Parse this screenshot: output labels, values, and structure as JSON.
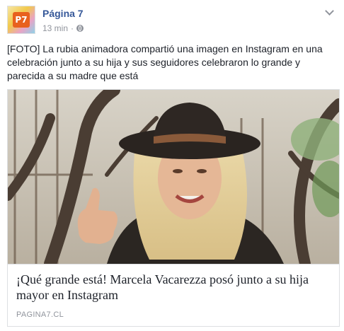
{
  "post": {
    "page_name": "Página 7",
    "avatar_text": "P7",
    "timestamp": "13 min",
    "separator": "·",
    "privacy_icon": "globe-icon",
    "menu_icon": "chevron-down-icon",
    "message": "[FOTO] La rubia animadora compartió una imagen en Instagram en una celebración junto a su hija y sus seguidores celebraron lo grande y parecida a su madre que está"
  },
  "link_card": {
    "image_icon": "photo-of-woman-with-hat",
    "title": "¡Qué grande está! Marcela Vacarezza posó junto a su hija mayor en Instagram",
    "source": "PAGINA7.CL"
  },
  "colors": {
    "link_blue": "#365899",
    "meta_gray": "#90949c",
    "text": "#1d2129",
    "border": "#dddfe2",
    "logo_orange": "#e8611e"
  }
}
